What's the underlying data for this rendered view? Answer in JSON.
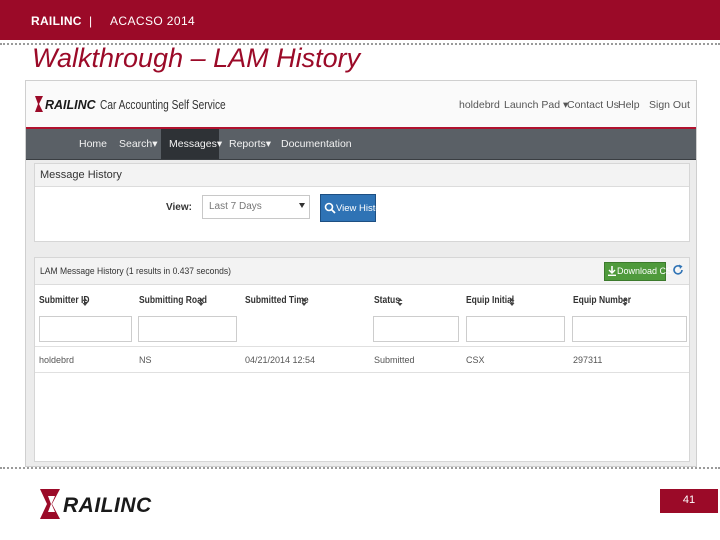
{
  "header": {
    "brand": "RAILINC",
    "separator": "|",
    "conference": "ACACSO 2014"
  },
  "slide": {
    "title": "Walkthrough – LAM History",
    "page_number": "41"
  },
  "colors": {
    "brand_red": "#9b0a28",
    "nav_dark": "#5a6066",
    "button_blue": "#2f73b5",
    "button_green": "#4f9a3c"
  },
  "app": {
    "logo_text": "RAILINC",
    "title": "Car Accounting Self Service",
    "top_links": [
      "holdebrd",
      "Launch Pad ▾",
      "Contact Us",
      "Help",
      "Sign Out"
    ],
    "nav": [
      "Home",
      "Search▾",
      "Messages▾",
      "Reports▾",
      "Documentation"
    ],
    "active_nav": "Messages▾",
    "section_title": "Message History",
    "view_label": "View:",
    "view_value": "Last 7 Days",
    "view_button": "View Histo",
    "results_title": "LAM Message History (1 results in 0.437 seconds)",
    "download_button": "Download CSV",
    "refresh_icon": "refresh-icon",
    "columns": [
      "Submitter ID",
      "Submitting Road",
      "Submitted Time",
      "Status",
      "Equip Initial",
      "Equip Number"
    ],
    "rows": [
      [
        "holdebrd",
        "NS",
        "04/21/2014 12:54",
        "Submitted",
        "CSX",
        "297311"
      ]
    ]
  },
  "footer": {
    "logo_text": "RAILINC"
  }
}
